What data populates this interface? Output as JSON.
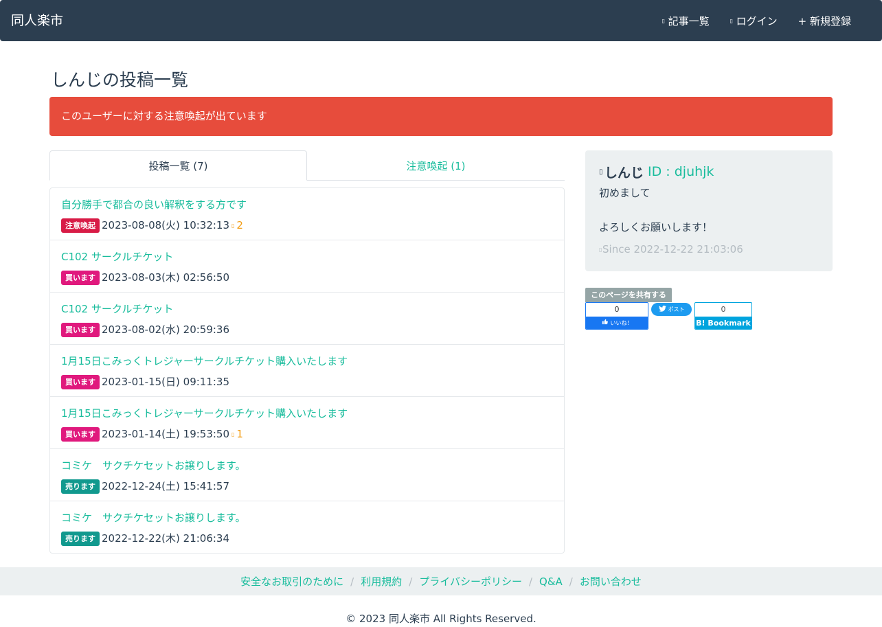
{
  "navbar": {
    "brand": "同人楽市",
    "items": [
      {
        "icon": "list-icon",
        "label": "記事一覧"
      },
      {
        "icon": "login-icon",
        "label": "ログイン"
      },
      {
        "icon": "plus-icon",
        "label": "+ 新規登録"
      }
    ]
  },
  "page": {
    "title": "しんじの投稿一覧",
    "alert": "このユーザーに対する注意喚起が出ています"
  },
  "tabs": [
    {
      "label": "投稿一覧 (7)",
      "active": true
    },
    {
      "label": "注意喚起 (1)",
      "active": false
    }
  ],
  "posts": [
    {
      "title": "自分勝手で都合の良い解釈をする方です",
      "badge": "注意喚起",
      "badge_type": "caution",
      "date": "2023-08-08(火) 10:32:13",
      "count": "2"
    },
    {
      "title": "C102 サークルチケット",
      "badge": "買います",
      "badge_type": "buy",
      "date": "2023-08-03(木) 02:56:50",
      "count": ""
    },
    {
      "title": "C102 サークルチケット",
      "badge": "買います",
      "badge_type": "buy",
      "date": "2023-08-02(水) 20:59:36",
      "count": ""
    },
    {
      "title": "1月15日こみっくトレジャーサークルチケット購入いたします",
      "badge": "買います",
      "badge_type": "buy",
      "date": "2023-01-15(日) 09:11:35",
      "count": ""
    },
    {
      "title": "1月15日こみっくトレジャーサークルチケット購入いたします",
      "badge": "買います",
      "badge_type": "buy",
      "date": "2023-01-14(土) 19:53:50",
      "count": "1"
    },
    {
      "title": "コミケ　サクチケセットお譲りします。",
      "badge": "売ります",
      "badge_type": "sell",
      "date": "2022-12-24(土) 15:41:57",
      "count": ""
    },
    {
      "title": "コミケ　サクチケセットお譲りします。",
      "badge": "売ります",
      "badge_type": "sell",
      "date": "2022-12-22(木) 21:06:34",
      "count": ""
    }
  ],
  "profile": {
    "name": "しんじ",
    "id": "ID : djuhjk",
    "bio": "初めまして\n\nよろしくお願いします！",
    "since": "Since 2022-12-22 21:03:06"
  },
  "share": {
    "label": "このページを共有する",
    "facebook_count": "0",
    "facebook_label": "いいね！",
    "twitter_label": "ポスト",
    "hatena_count": "0",
    "hatena_label": "B! Bookmark"
  },
  "footer": {
    "links": [
      "安全なお取引のために",
      "利用規約",
      "プライバシーポリシー",
      "Q&A",
      "お問い合わせ"
    ],
    "copyright": "© 2023 同人楽市 All Rights Reserved."
  },
  "colors": {
    "navbar": "#2c3e50",
    "accent": "#18bc9c",
    "alert": "#e74c3c",
    "caution_badge": "#d81b46",
    "buy_badge": "#e0197d",
    "sell_badge": "#11998e",
    "count": "#f39c12"
  }
}
